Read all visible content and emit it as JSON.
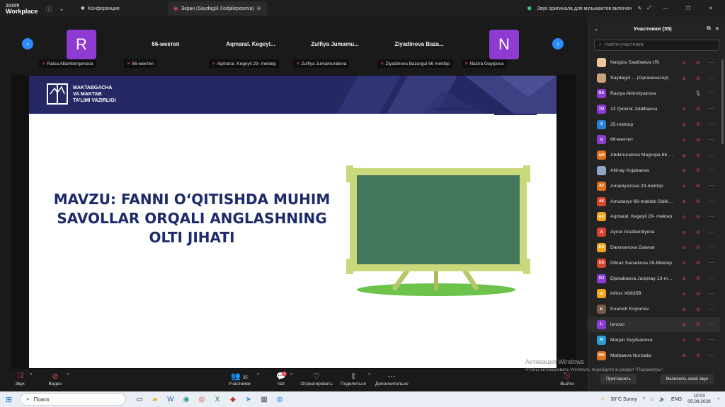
{
  "app": {
    "logo_line1": "zoom",
    "logo_line2": "Workplace"
  },
  "tabs": [
    {
      "label": "Конференция"
    },
    {
      "label": "Экран (Saydagül Xodjalepesova)"
    }
  ],
  "titlebar_status": "Звук оригинала для музыкантов включен",
  "participants_strip": [
    {
      "avatar": "R",
      "name": "",
      "label": "Raisa Allambergenova"
    },
    {
      "avatar": "",
      "name": "66-мектеп",
      "label": "66-мектеп"
    },
    {
      "avatar": "",
      "name": "Aqmaral. Kegeyl...",
      "label": "Aqmaral. Kegeyli 29- mektep"
    },
    {
      "avatar": "",
      "name": "Zulfiya Jumamu...",
      "label": "Zulfiya Jumamuratova"
    },
    {
      "avatar": "",
      "name": "Ziyadinova Baza...",
      "label": "Ziyadinova Bazargul 66 mektep"
    },
    {
      "avatar": "N",
      "name": "",
      "label": "Nazira Gayipova"
    }
  ],
  "slide": {
    "ministry_line1": "MAKTABGACHA",
    "ministry_line2": "VA MAKTAB",
    "ministry_line3": "TA'LIMI VAZIRLIGI",
    "title_line1": "MAVZU: FANNI O‘QITISHDA MUHIM",
    "title_line2": "SAVOLLAR ORQALI  ANGLASHNING",
    "title_line3": "OLTI JIHATI"
  },
  "controls": {
    "audio": "Звук",
    "video": "Видео",
    "participants": "Участники",
    "participants_count": "35",
    "chat": "Чат",
    "chat_badge": "1",
    "react": "Отреагировать",
    "share": "Поделиться",
    "more": "Дополнительно",
    "leave": "Выйти"
  },
  "panel": {
    "title": "Участники (35)",
    "search_placeholder": "Найти участника",
    "invite": "Пригласить",
    "unmute_self": "Включить свой звук"
  },
  "participants": [
    {
      "initials": "",
      "color": "#f2c49b",
      "name": "Nargiza Saatbaeva (Я)"
    },
    {
      "initials": "",
      "color": "#c9a27e",
      "name": "Saydagül ...  (Организатор)"
    },
    {
      "initials": "RA",
      "color": "#8e3bd1",
      "name": "Raziya Akimniyazova"
    },
    {
      "initials": "1Q",
      "color": "#8e3bd1",
      "name": "13 Qonirat Joldibaeva"
    },
    {
      "initials": "2",
      "color": "#2d7fd4",
      "name": "25-mektep"
    },
    {
      "initials": "6",
      "color": "#8e3bd1",
      "name": "66-мектеп"
    },
    {
      "initials": "AM",
      "color": "#e0721f",
      "name": "Abdimuratova Magrupa 66 m..."
    },
    {
      "initials": "",
      "color": "#8fa6c4",
      "name": "Altinay Xojabaeva"
    },
    {
      "initials": "A2",
      "color": "#e0721f",
      "name": "Amaniyazova 29-mektep"
    },
    {
      "initials": "A6",
      "color": "#d9442f",
      "name": "Amudaryo 66-maktab Sidikov ..."
    },
    {
      "initials": "AK",
      "color": "#f0a51d",
      "name": "Aqmaral. Kegeyli 29- mektep"
    },
    {
      "initials": "A",
      "color": "#d9442f",
      "name": "Aynur Arazberdiyeva"
    },
    {
      "initials": "DG",
      "color": "#f0a51d",
      "name": "Dawrxanova Gawxar"
    },
    {
      "initials": "DS",
      "color": "#d9442f",
      "name": "Dilnaz Sarsekova 29-Mektep"
    },
    {
      "initials": "DJ",
      "color": "#8e3bd1",
      "name": "Djanabaeva Jarqinay 13-mektep"
    },
    {
      "initials": "IX",
      "color": "#f0a51d",
      "name": "Infinix X6835B"
    },
    {
      "initials": "K",
      "color": "#7a5a4a",
      "name": "Kuanish Koylanov"
    },
    {
      "initials": "L",
      "color": "#8e3bd1",
      "name": "lenovo"
    },
    {
      "initials": "M",
      "color": "#2d9ad4",
      "name": "Marjan Seyitxanova"
    },
    {
      "initials": "MN",
      "color": "#e0721f",
      "name": "Matbaeva Nurzada"
    }
  ],
  "watermark": {
    "line1": "Активация Windows",
    "line2": "Чтобы активировать Windows, перейдите в раздел \"Параметры\"."
  },
  "taskbar": {
    "search": "Поиск",
    "weather": "30°C  Sunny",
    "lang": "ENG",
    "time": "10:03",
    "date": "05.08.2026"
  },
  "colors": {
    "slide_header": "#262864",
    "title_text": "#1d2a6b",
    "accent_blue": "#2d8cff",
    "muted_red": "#e04a4a"
  }
}
